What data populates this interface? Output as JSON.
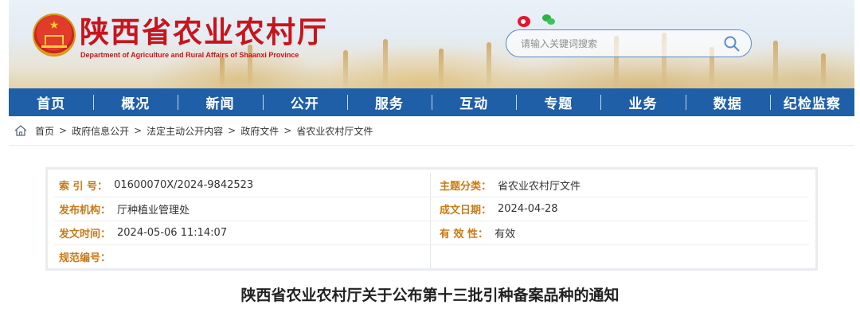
{
  "header": {
    "title": "陕西省农业农村厅",
    "subtitle": "Department of Agriculture and Rural Affairs of Shaanxi Province",
    "emblem_icon": "national-emblem-icon"
  },
  "share": {
    "weibo_icon": "weibo-icon",
    "wechat_icon": "wechat-icon"
  },
  "search": {
    "placeholder": "请输入关键词搜索",
    "icon": "search-icon"
  },
  "nav": {
    "items": [
      "首页",
      "概况",
      "新闻",
      "公开",
      "服务",
      "互动",
      "专题",
      "业务",
      "数据",
      "纪检监察"
    ]
  },
  "breadcrumb": {
    "icon": "home-icon",
    "items": [
      "首页",
      "政府信息公开",
      "法定主动公开内容",
      "政府文件",
      "省农业农村厅文件"
    ],
    "separator": ">"
  },
  "meta": {
    "index_label": "索 引 号：",
    "index_value": "01600070X/2024-9842523",
    "topic_label": "主题分类：",
    "topic_value": "省农业农村厅文件",
    "org_label": "发布机构：",
    "org_value": "厅种植业管理处",
    "date_label": "成文日期：",
    "date_value": "2024-04-28",
    "pub_label": "发文时间：",
    "pub_value": "2024-05-06 11:14:07",
    "valid_label": "有 效 性：",
    "valid_value": "有效",
    "code_label": "规范编号：",
    "code_value": ""
  },
  "article": {
    "title": "陕西省农业农村厅关于公布第十三批引种备案品种的通知"
  },
  "colors": {
    "brand_red": "#c8141b",
    "nav_blue": "#1f5fa8",
    "label_orange": "#c97a13"
  }
}
